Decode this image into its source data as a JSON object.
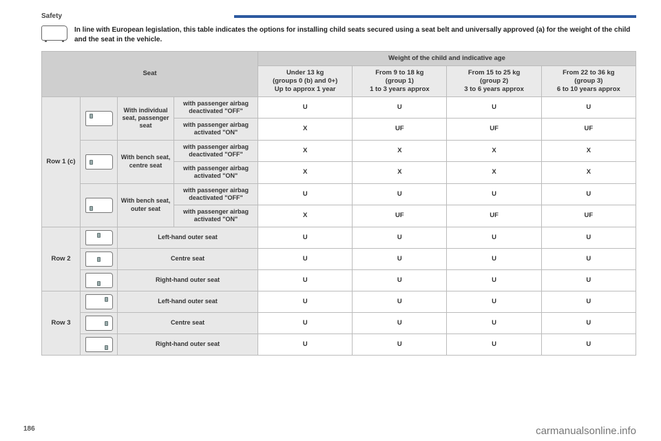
{
  "section": "Safety",
  "intro": "In line with European legislation, this table indicates the options for installing child seats secured using a seat belt and universally approved (a) for the weight of the child and the seat in the vehicle.",
  "headers": {
    "seat": "Seat",
    "weight_title": "Weight of the child and indicative age",
    "cols": [
      {
        "title": "Under 13 kg",
        "sub1": "(groups 0 (b) and 0+)",
        "sub2": "Up to approx 1 year"
      },
      {
        "title": "From 9 to 18 kg",
        "sub1": "(group 1)",
        "sub2": "1 to 3 years approx"
      },
      {
        "title": "From 15 to 25 kg",
        "sub1": "(group 2)",
        "sub2": "3 to 6 years approx"
      },
      {
        "title": "From 22 to 36 kg",
        "sub1": "(group 3)",
        "sub2": "6 to 10 years approx"
      }
    ]
  },
  "row1_label": "Row 1 (c)",
  "row1": [
    {
      "seat": "With individual seat, passenger seat",
      "lines": [
        {
          "airbag": "with passenger airbag deactivated \"OFF\"",
          "vals": [
            "U",
            "U",
            "U",
            "U"
          ]
        },
        {
          "airbag": "with passenger airbag activated \"ON\"",
          "vals": [
            "X",
            "UF",
            "UF",
            "UF"
          ]
        }
      ]
    },
    {
      "seat": "With bench seat, centre seat",
      "lines": [
        {
          "airbag": "with passenger airbag deactivated \"OFF\"",
          "vals": [
            "X",
            "X",
            "X",
            "X"
          ]
        },
        {
          "airbag": "with passenger airbag activated \"ON\"",
          "vals": [
            "X",
            "X",
            "X",
            "X"
          ]
        }
      ]
    },
    {
      "seat": "With bench seat, outer seat",
      "lines": [
        {
          "airbag": "with passenger airbag deactivated \"OFF\"",
          "vals": [
            "U",
            "U",
            "U",
            "U"
          ]
        },
        {
          "airbag": "with passenger airbag activated \"ON\"",
          "vals": [
            "X",
            "UF",
            "UF",
            "UF"
          ]
        }
      ]
    }
  ],
  "row2_label": "Row 2",
  "row2": [
    {
      "seat": "Left-hand outer seat",
      "vals": [
        "U",
        "U",
        "U",
        "U"
      ]
    },
    {
      "seat": "Centre seat",
      "vals": [
        "U",
        "U",
        "U",
        "U"
      ]
    },
    {
      "seat": "Right-hand outer seat",
      "vals": [
        "U",
        "U",
        "U",
        "U"
      ]
    }
  ],
  "row3_label": "Row 3",
  "row3": [
    {
      "seat": "Left-hand outer seat",
      "vals": [
        "U",
        "U",
        "U",
        "U"
      ]
    },
    {
      "seat": "Centre seat",
      "vals": [
        "U",
        "U",
        "U",
        "U"
      ]
    },
    {
      "seat": "Right-hand outer seat",
      "vals": [
        "U",
        "U",
        "U",
        "U"
      ]
    }
  ],
  "page_number": "186",
  "watermark": "carmanualsonline.info"
}
